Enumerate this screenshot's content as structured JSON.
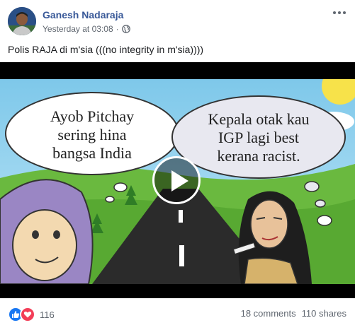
{
  "post": {
    "author": "Ganesh Nadaraja",
    "timestamp": "Yesterday at 03:08",
    "separator": "·",
    "privacy_icon": "globe-icon",
    "caption": "Polis RAJA di m'sia (((no integrity in m'sia))))",
    "more_icon": "more-options-icon"
  },
  "video": {
    "bubble_left": [
      "Ayob Pitchay",
      "sering hina",
      "bangsa India"
    ],
    "bubble_right": [
      "Kepala otak kau",
      "IGP lagi best",
      "kerana racist."
    ],
    "play_icon": "play-icon"
  },
  "footer": {
    "reaction_count": "116",
    "comments": "18 comments",
    "shares": "110 shares",
    "reaction_icons": [
      "like-icon",
      "love-icon"
    ]
  },
  "colors": {
    "link": "#385898",
    "secondary": "#606770",
    "like": "#1877f2",
    "love": "#f33e58"
  }
}
